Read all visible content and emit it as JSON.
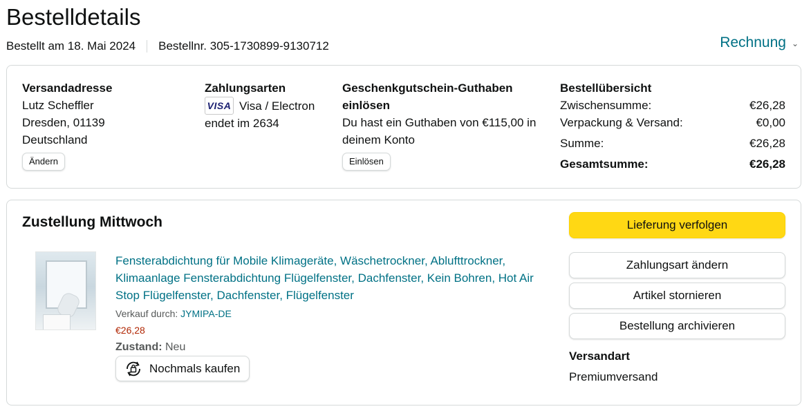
{
  "header": {
    "title": "Bestelldetails",
    "ordered_on": "Bestellt am 18. Mai 2024",
    "order_number": "Bestellnr. 305-1730899-9130712",
    "invoice_label": "Rechnung"
  },
  "shipping_address": {
    "heading": "Versandadresse",
    "name": "Lutz Scheffler",
    "city": "Dresden, 01139",
    "country": "Deutschland",
    "change_label": "Ändern"
  },
  "payment": {
    "heading": "Zahlungsarten",
    "card_brand": "VISA",
    "card_type": "Visa / Electron",
    "card_ending": "endet im 2634"
  },
  "gift_card": {
    "heading": "Geschenkgutschein-Guthaben einlösen",
    "balance_text": "Du hast ein Guthaben von €115,00 in deinem Konto",
    "redeem_label": "Einlösen"
  },
  "order_summary": {
    "heading": "Bestellübersicht",
    "rows": [
      {
        "label": "Zwischensumme:",
        "value": "€26,28"
      },
      {
        "label": "Verpackung & Versand:",
        "value": "€0,00"
      },
      {
        "label": "Summe:",
        "value": "€26,28"
      }
    ],
    "total_label": "Gesamtsumme:",
    "total_value": "€26,28"
  },
  "delivery": {
    "title": "Zustellung Mittwoch",
    "product": {
      "title": "Fensterabdichtung für Mobile Klimageräte, Wäschetrockner, Ablufttrockner, Klimaanlage Fensterabdichtung Flügelfenster, Dachfenster, Kein Bohren, Hot Air Stop Flügelfenster, Dachfenster, Flügelfenster",
      "sold_by_label": "Verkauf durch:",
      "seller": "JYMIPA-DE",
      "price": "€26,28",
      "condition_label": "Zustand:",
      "condition_value": "Neu",
      "buy_again_label": "Nochmals kaufen"
    },
    "actions": {
      "track": "Lieferung verfolgen",
      "change_payment": "Zahlungsart ändern",
      "cancel": "Artikel stornieren",
      "archive": "Bestellung archivieren"
    },
    "shipping_method_heading": "Versandart",
    "shipping_method": "Premiumversand"
  },
  "colors": {
    "link": "#007185",
    "price": "#b12704",
    "primary_button": "#ffd814",
    "border": "#d5d9d9"
  },
  "icons": {
    "invoice_dropdown": "chevron-down-icon",
    "buy_again": "buy-again-icon"
  }
}
